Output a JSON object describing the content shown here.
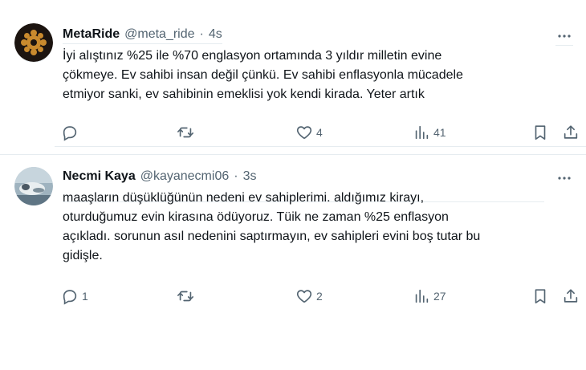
{
  "tweets": [
    {
      "name": "MetaRide",
      "handle": "@meta_ride",
      "separator": "·",
      "time": "4s",
      "text_lines": [
        "İyi alıştınız %25 ile %70 englasyon ortamında 3 yıldır milletin evine",
        "çökmeye. Ev sahibi insan değil çünkü. Ev sahibi enflasyonla mücadele",
        "etmiyor sanki, ev sahibinin emeklisi yok kendi kirada. Yeter artık"
      ],
      "replies": "",
      "retweets": "",
      "likes": "4",
      "views": "41"
    },
    {
      "name": "Necmi Kaya",
      "handle": "@kayanecmi06",
      "separator": "·",
      "time": "3s",
      "text_lines": [
        "maaşların düşüklüğünün nedeni ev sahiplerimi. aldığımız kirayı,",
        "oturduğumuz evin kirasına ödüyoruz.  Tüik ne zaman %25 enflasyon",
        "açıkladı. sorunun asıl nedenini saptırmayın, ev sahipleri evini boş tutar bu",
        "gidişle."
      ],
      "replies": "1",
      "retweets": "",
      "likes": "2",
      "views": "27"
    }
  ],
  "icons": {
    "reply": "reply-icon",
    "retweet": "retweet-icon",
    "like": "heart-icon",
    "views": "views-icon",
    "bookmark": "bookmark-icon",
    "share": "share-icon",
    "more": "more-icon"
  },
  "colors": {
    "text": "#0f1419",
    "muted": "#536471",
    "divider": "#e6ecf0"
  }
}
